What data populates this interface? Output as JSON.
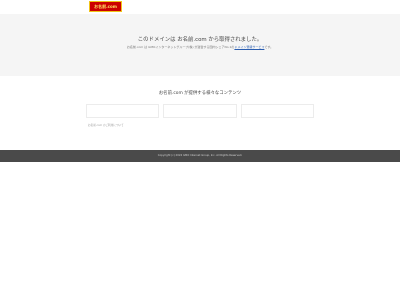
{
  "header": {
    "logo_text": "お名前.com"
  },
  "notice": {
    "title": "このドメインは お名前.com から取得されました。",
    "subtitle_before": "お名前.com は GMOインターネットグループ(株) が運営する国内シェアNo.1の",
    "subtitle_link": "ドメイン登録サービス",
    "subtitle_after": "です。"
  },
  "content": {
    "title": "お名前.com が提供する様々なコンテンツ",
    "small_link": "お名前.com のご利用について"
  },
  "footer": {
    "copyright": "Copyright (c) 2024 GMO Internet Group, Inc. All Rights Reserved."
  }
}
